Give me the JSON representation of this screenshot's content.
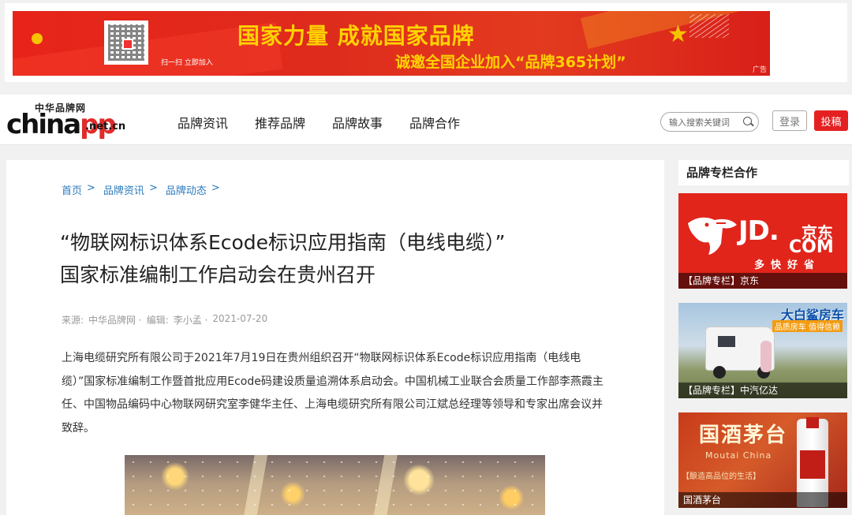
{
  "banner": {
    "title": "国家力量 成就国家品牌",
    "subtitle": "诚邀全国企业加入“品牌365计划”",
    "qr_label": "扫一扫 立即加入",
    "ad_label": "广告"
  },
  "header": {
    "logo_top": "中华品牌网",
    "logo_china": "china",
    "logo_pp": "pp",
    "logo_suffix": ".net.cn",
    "nav": [
      "品牌资讯",
      "推荐品牌",
      "品牌故事",
      "品牌合作"
    ],
    "search_placeholder": "输入搜索关键词",
    "login_label": "登录",
    "submit_label": "投稿"
  },
  "breadcrumb": {
    "items": [
      "首页",
      "品牌资讯",
      "品牌动态"
    ],
    "separator": ">"
  },
  "article": {
    "title_line1": "“物联网标识体系Ecode标识应用指南（电线电缆）”",
    "title_line2": "国家标准编制工作启动会在贵州召开",
    "meta_source_label": "来源:",
    "meta_source": "中华品牌网 ·",
    "meta_editor_label": "编辑:",
    "meta_editor": "李小孟 ·",
    "meta_date": "2021-07-20",
    "paragraph": "上海电缆研究所有限公司于2021年7月19日在贵州组织召开“物联网标识体系Ecode标识应用指南（电线电缆）”国家标准编制工作暨首批应用Ecode码建设质量追溯体系启动会。中国机械工业联合会质量工作部李燕霞主任、中国物品编码中心物联网研究室李健华主任、上海电缆研究所有限公司江斌总经理等领导和专家出席会议并致辞。"
  },
  "sidebar": {
    "title": "品牌专栏合作",
    "cards": [
      {
        "caption": "【品牌专栏】京东",
        "logo": "JD.",
        "cn": "京东",
        "com": "COM",
        "slogan": "多快好省"
      },
      {
        "caption": "【品牌专栏】中汽亿达",
        "title": "大白鲨房车",
        "sub": "品质房车 值得信赖"
      },
      {
        "caption": "国酒茅台",
        "cn": "国酒茅台",
        "en": "Moutai China",
        "slogan": "【酿造高品位的生活】"
      }
    ]
  }
}
